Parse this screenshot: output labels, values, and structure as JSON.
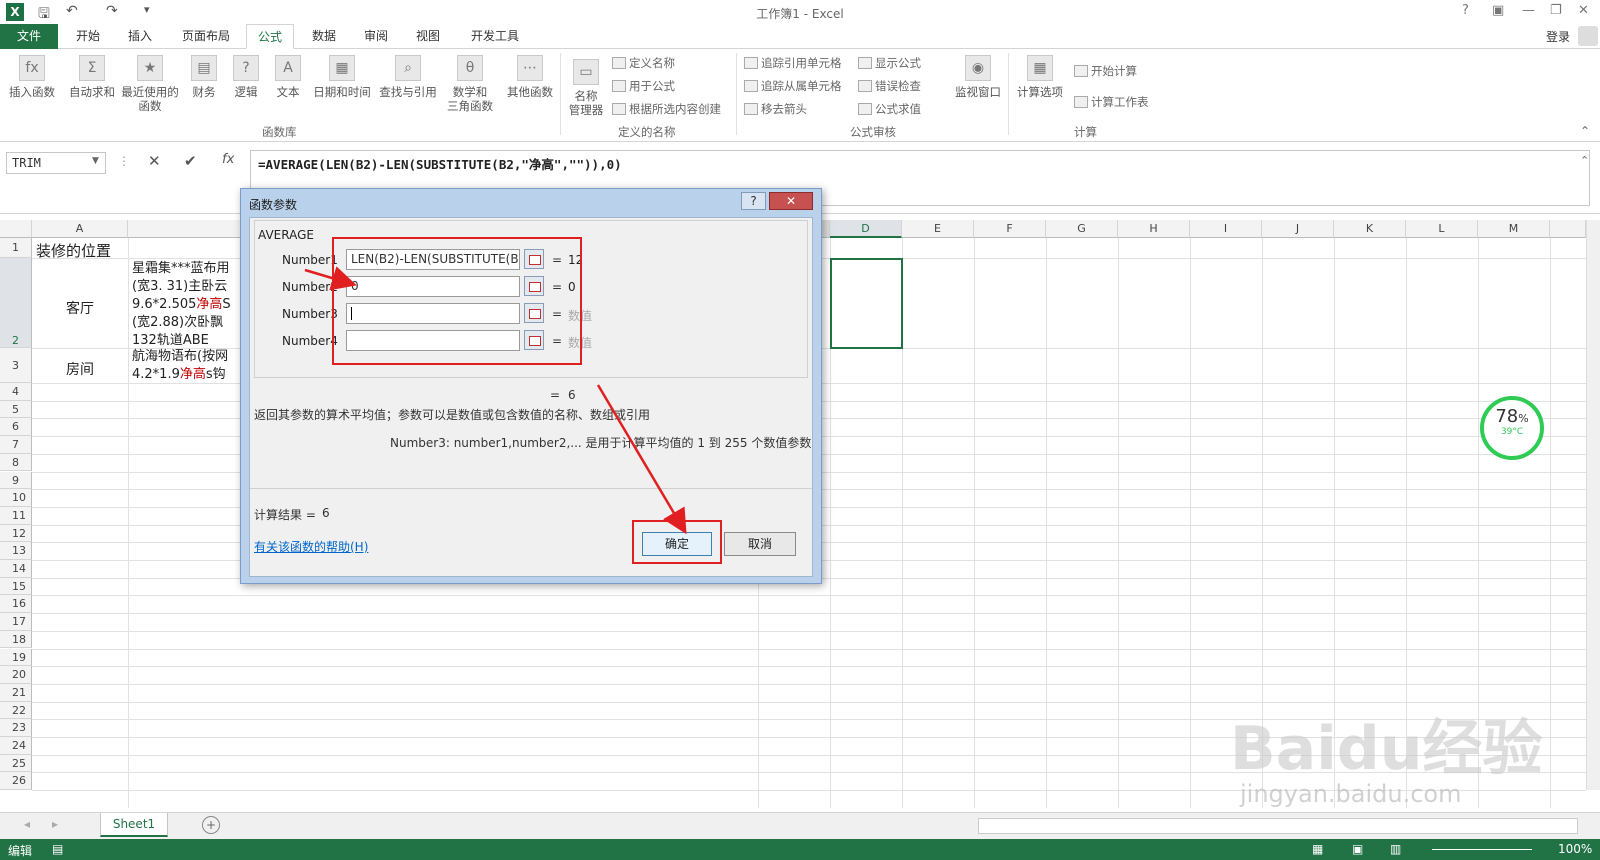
{
  "window": {
    "title": "工作簿1 - Excel",
    "login": "登录"
  },
  "ribbon_tabs": [
    "文件",
    "开始",
    "插入",
    "页面布局",
    "公式",
    "数据",
    "审阅",
    "视图",
    "开发工具"
  ],
  "ribbon": {
    "big": [
      {
        "label": "插入函数",
        "icon": "fx"
      },
      {
        "label": "自动求和",
        "icon": "Σ"
      },
      {
        "label": "最近使用的\n函数",
        "icon": "★"
      },
      {
        "label": "财务",
        "icon": "▤"
      },
      {
        "label": "逻辑",
        "icon": "?"
      },
      {
        "label": "文本",
        "icon": "A"
      },
      {
        "label": "日期和时间",
        "icon": "▦"
      },
      {
        "label": "查找与引用",
        "icon": "⌕"
      },
      {
        "label": "数学和\n三角函数",
        "icon": "θ"
      },
      {
        "label": "其他函数",
        "icon": "⋯"
      },
      {
        "label": "名称\n管理器",
        "icon": "▭"
      },
      {
        "label": "监视窗口",
        "icon": "◉"
      },
      {
        "label": "计算选项",
        "icon": "▦"
      }
    ],
    "small": [
      "定义名称",
      "用于公式",
      "根据所选内容创建",
      "追踪引用单元格",
      "追踪从属单元格",
      "移去箭头",
      "显示公式",
      "错误检查",
      "公式求值",
      "开始计算",
      "计算工作表"
    ],
    "groups": [
      "函数库",
      "定义的名称",
      "公式审核",
      "计算"
    ]
  },
  "formula_bar": {
    "name_box": "TRIM",
    "formula": "=AVERAGE(LEN(B2)-LEN(SUBSTITUTE(B2,\"净高\",\"\")),0)"
  },
  "columns": [
    "A",
    "D",
    "E",
    "F",
    "G",
    "H",
    "I",
    "J",
    "K",
    "L",
    "M"
  ],
  "rows": [
    "1",
    "2",
    "3",
    "4",
    "5",
    "6",
    "7",
    "8",
    "9",
    "10",
    "11",
    "12",
    "13",
    "14",
    "15",
    "16",
    "17",
    "18",
    "19",
    "20",
    "21",
    "22",
    "23",
    "24",
    "25",
    "26"
  ],
  "cells": {
    "a1": "装修的位置",
    "a2": "客厅",
    "a3": "房间",
    "b2_lines": [
      "星霜集***蓝布用",
      "(宽3. 31)主卧云",
      "9.6*2.505净高S",
      "(宽2.88)次卧飘",
      "132轨道ABE"
    ],
    "b3_lines": [
      "航海物语布(按网",
      "4.2*1.9净高s钩"
    ]
  },
  "dialog": {
    "title": "函数参数",
    "function": "AVERAGE",
    "args": [
      {
        "label": "Number1",
        "value": "LEN(B2)-LEN(SUBSTITUTE(B2",
        "result": "12",
        "dim": false
      },
      {
        "label": "Number2",
        "value": "0",
        "result": "0",
        "dim": false
      },
      {
        "label": "Number3",
        "value": "",
        "result": "数值",
        "dim": true
      },
      {
        "label": "Number4",
        "value": "",
        "result": "数值",
        "dim": true
      }
    ],
    "eq_symbol": "=",
    "overall": "6",
    "description": "返回其参数的算术平均值；参数可以是数值或包含数值的名称、数组或引用",
    "arg_desc": "Number3:  number1,number2,... 是用于计算平均值的 1 到 255 个数值参数",
    "result_label": "计算结果 =",
    "result_value": "6",
    "help_link": "有关该函数的帮助(H)",
    "ok": "确定",
    "cancel": "取消"
  },
  "widget": {
    "percent": "78",
    "percent_sign": "%",
    "temp": "39°C"
  },
  "sheet_tab": "Sheet1",
  "status": {
    "mode": "编辑",
    "zoom": "100%"
  },
  "watermark": {
    "text": "Baidu经验",
    "url": "jingyan.baidu.com"
  },
  "colors": {
    "excel_green": "#217346",
    "highlight_red": "#e02020"
  }
}
